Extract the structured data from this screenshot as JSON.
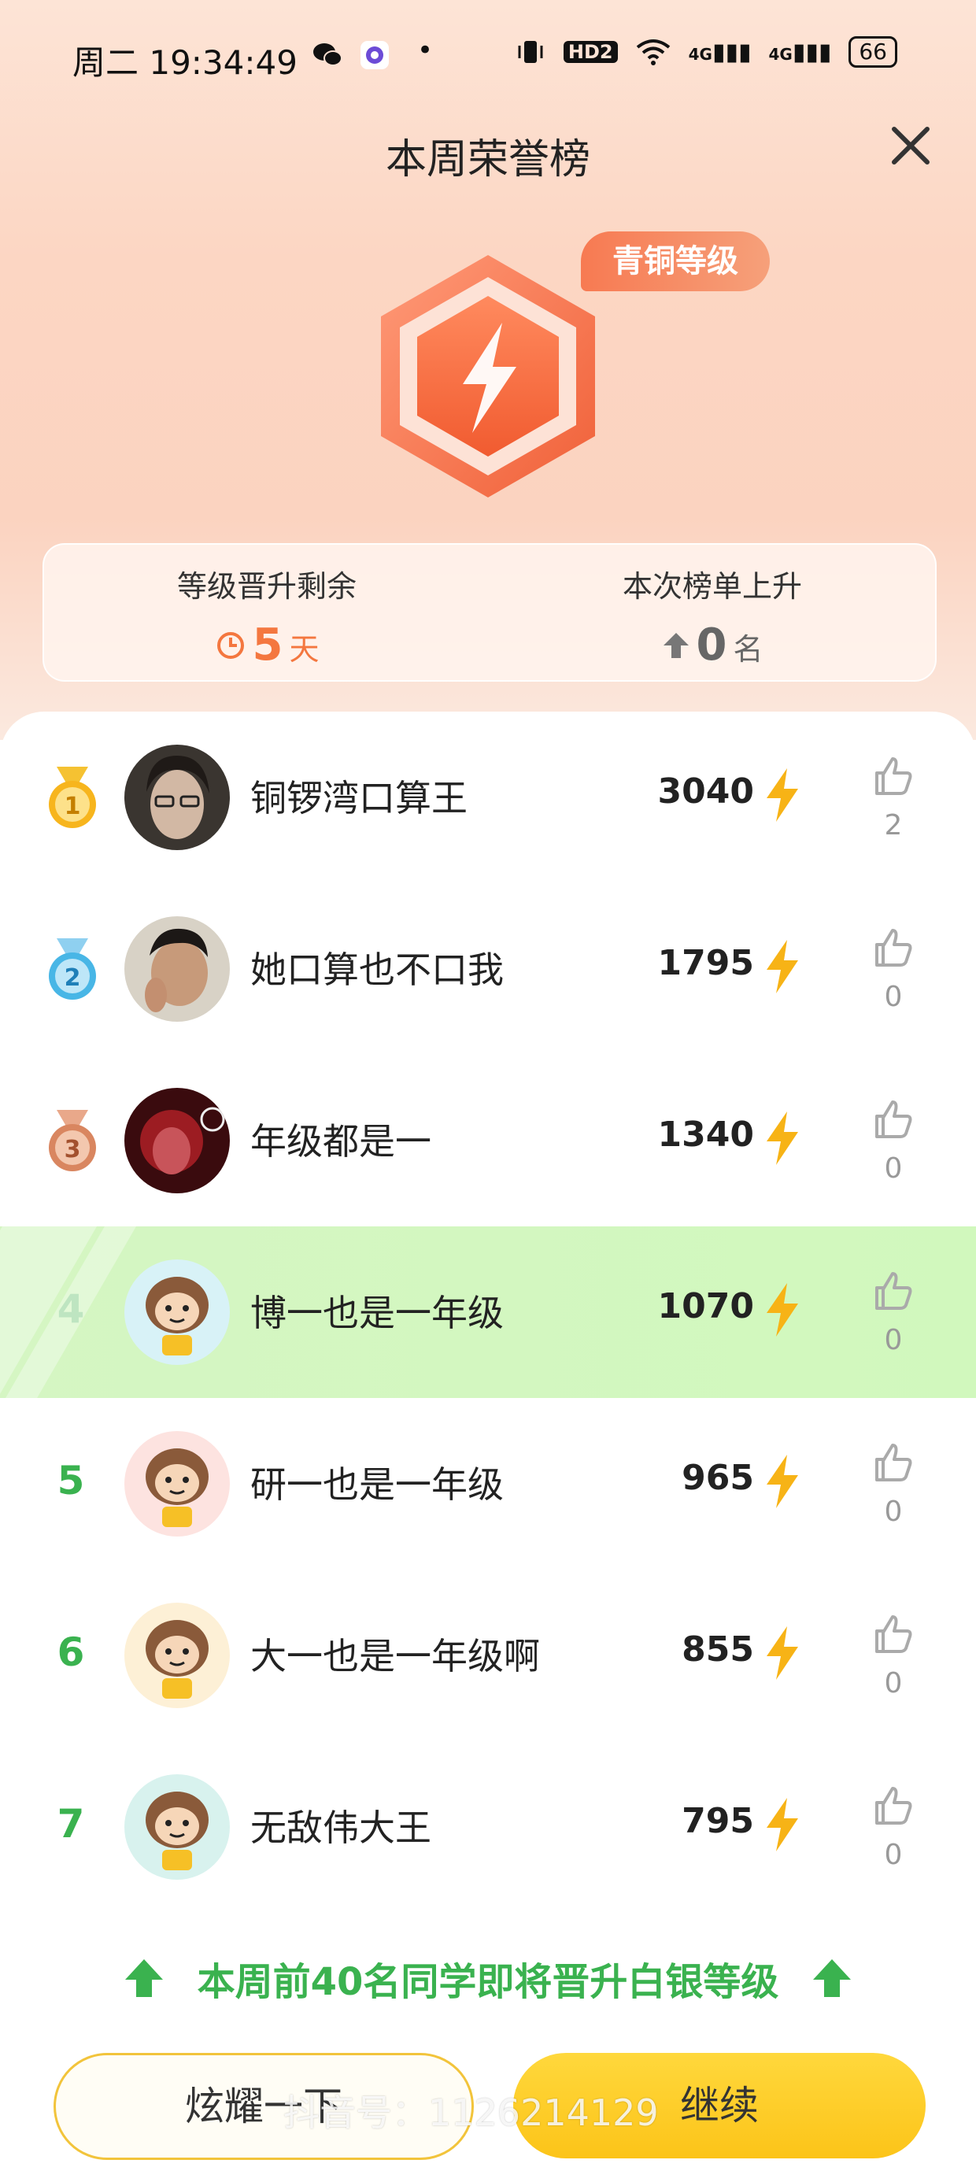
{
  "status_bar": {
    "time": "周二 19:34:49",
    "network1": "4G",
    "network2": "4G",
    "hd": "HD2",
    "battery": "66"
  },
  "header": {
    "title": "本周荣誉榜"
  },
  "badge": {
    "label": "青铜等级"
  },
  "stats": {
    "left": {
      "label": "等级晋升剩余",
      "value": "5",
      "unit": "天"
    },
    "right": {
      "label": "本次榜单上升",
      "value": "0",
      "unit": "名"
    }
  },
  "leaderboard": [
    {
      "rank": "1",
      "name": "铜锣湾口算王",
      "score": "3040",
      "likes": "2"
    },
    {
      "rank": "2",
      "name": "她口算也不口我",
      "score": "1795",
      "likes": "0"
    },
    {
      "rank": "3",
      "name": "年级都是一",
      "score": "1340",
      "likes": "0"
    },
    {
      "rank": "4",
      "name": "博一也是一年级",
      "score": "1070",
      "likes": "0"
    },
    {
      "rank": "5",
      "name": "研一也是一年级",
      "score": "965",
      "likes": "0"
    },
    {
      "rank": "6",
      "name": "大一也是一年级啊",
      "score": "855",
      "likes": "0"
    },
    {
      "rank": "7",
      "name": "无敌伟大王",
      "score": "795",
      "likes": "0"
    }
  ],
  "promo": {
    "text": "本周前40名同学即将晋升白银等级"
  },
  "buttons": {
    "show_off": "炫耀一下",
    "continue": "继续"
  },
  "watermark": "抖音号：1126214129",
  "colors": {
    "accent_green": "#3ab24f",
    "badge_orange": "#f77a52",
    "button_yellow": "#fcc419"
  }
}
